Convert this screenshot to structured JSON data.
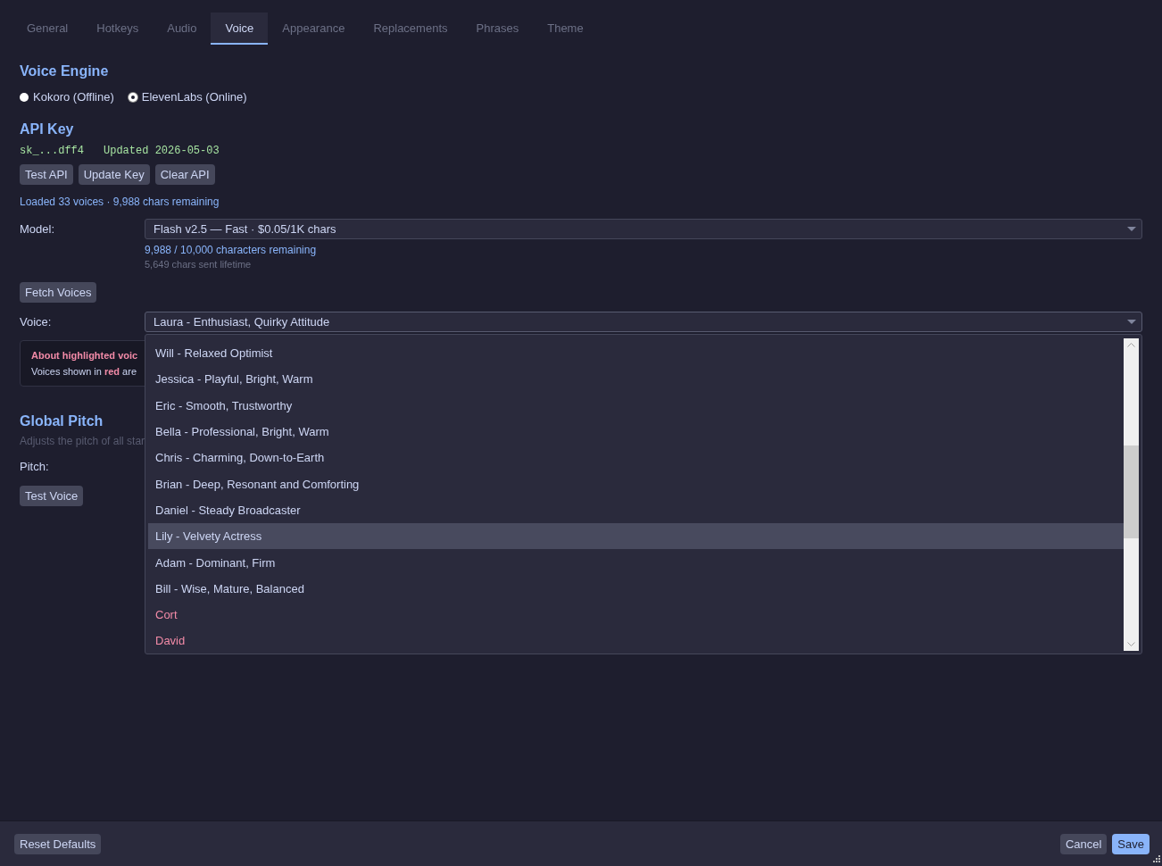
{
  "tabs": [
    {
      "label": "General",
      "selected": false
    },
    {
      "label": "Hotkeys",
      "selected": false
    },
    {
      "label": "Audio",
      "selected": false
    },
    {
      "label": "Voice",
      "selected": true
    },
    {
      "label": "Appearance",
      "selected": false
    },
    {
      "label": "Replacements",
      "selected": false
    },
    {
      "label": "Phrases",
      "selected": false
    },
    {
      "label": "Theme",
      "selected": false
    }
  ],
  "voice_engine": {
    "title": "Voice Engine",
    "options": [
      {
        "label": "Kokoro (Offline)",
        "selected": false
      },
      {
        "label": "ElevenLabs (Online)",
        "selected": true
      }
    ]
  },
  "api_key": {
    "title": "API Key",
    "key": "sk_...dff4",
    "updated": "Updated 2026-05-03",
    "buttons": [
      "Test API",
      "Update Key",
      "Clear API"
    ],
    "status": "Loaded 33 voices · 9,988 chars remaining"
  },
  "model": {
    "label": "Model:",
    "value": "Flash v2.5 — Fast · $0.05/1K chars",
    "quota": "9,988 / 10,000 characters remaining",
    "lifetime": "5,649 chars sent lifetime"
  },
  "fetch_button": "Fetch Voices",
  "voice": {
    "label": "Voice:",
    "value": "Laura - Enthusiast, Quirky Attitude",
    "expanded": true,
    "options": [
      {
        "label": "Will - Relaxed Optimist",
        "selected": false,
        "highlighted": false
      },
      {
        "label": "Jessica - Playful, Bright, Warm",
        "selected": false,
        "highlighted": false
      },
      {
        "label": "Eric - Smooth, Trustworthy",
        "selected": false,
        "highlighted": false
      },
      {
        "label": "Bella - Professional, Bright, Warm",
        "selected": false,
        "highlighted": false
      },
      {
        "label": "Chris - Charming, Down-to-Earth",
        "selected": false,
        "highlighted": false
      },
      {
        "label": "Brian - Deep, Resonant and Comforting",
        "selected": false,
        "highlighted": false
      },
      {
        "label": "Daniel - Steady Broadcaster",
        "selected": false,
        "highlighted": false
      },
      {
        "label": "Lily - Velvety Actress",
        "selected": true,
        "highlighted": false
      },
      {
        "label": "Adam - Dominant, Firm",
        "selected": false,
        "highlighted": false
      },
      {
        "label": "Bill - Wise, Mature, Balanced",
        "selected": false,
        "highlighted": false
      },
      {
        "label": "Cort",
        "selected": false,
        "highlighted": true
      },
      {
        "label": "David",
        "selected": false,
        "highlighted": true
      }
    ]
  },
  "notice": {
    "title": "About highlighted voic",
    "text": "Voices shown in **red** are"
  },
  "global_pitch": {
    "title": "Global Pitch",
    "description": "Adjusts the pitch of all star",
    "pitch_label": "Pitch:",
    "test_button": "Test Voice"
  },
  "footer": {
    "reset": "Reset Defaults",
    "cancel": "Cancel",
    "save": "Save"
  }
}
